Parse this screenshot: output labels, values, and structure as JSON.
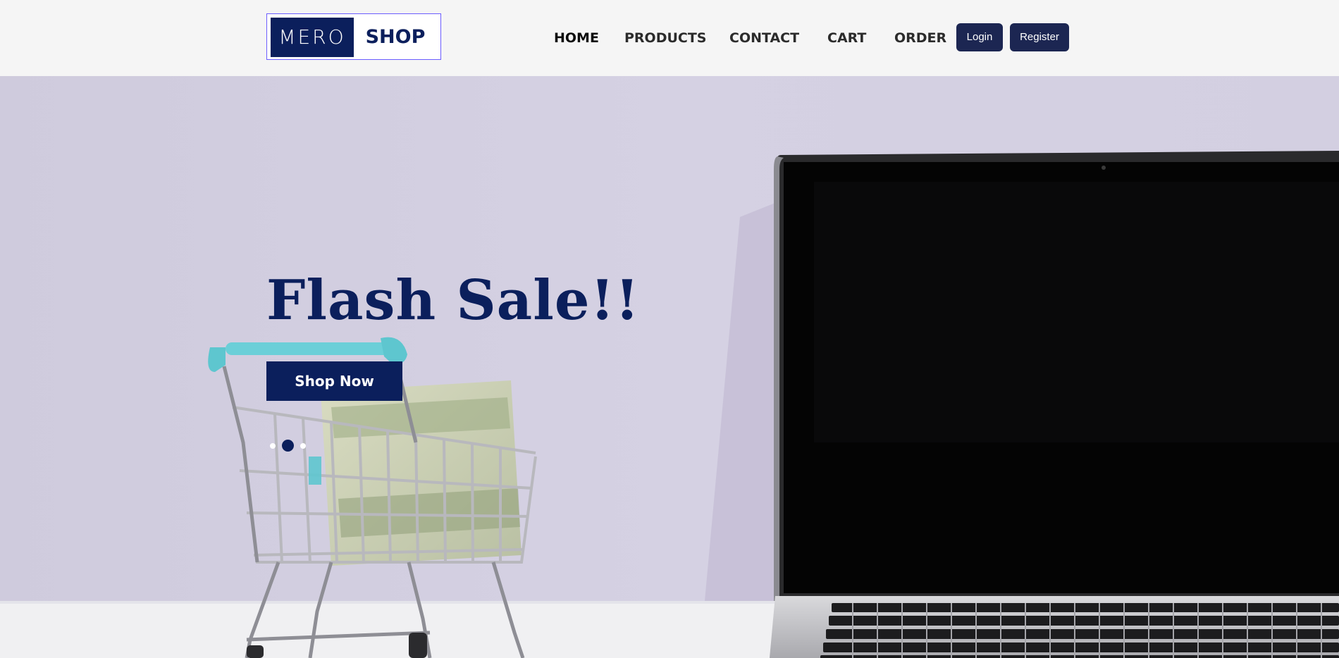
{
  "header": {
    "logo": {
      "left": "MERO",
      "right": "SHOP"
    },
    "nav": [
      {
        "label": "HOME",
        "active": true
      },
      {
        "label": "PRODUCTS",
        "active": false
      },
      {
        "label": "CONTACT",
        "active": false
      },
      {
        "label": "CART",
        "active": false
      },
      {
        "label": "ORDER",
        "active": false
      }
    ],
    "login_label": "Login",
    "register_label": "Register"
  },
  "hero": {
    "title": "Flash Sale!!",
    "button_label": "Shop Now",
    "slides_total": 3,
    "active_slide": 2,
    "image_subject": "shopping cart holding dollar bills beside an open laptop"
  },
  "colors": {
    "brand_navy": "#0b1f5c",
    "button_navy": "#1c2652",
    "logo_border": "#6b5cff",
    "header_bg": "#f5f5f5",
    "hero_bg": "#d2cfe0"
  }
}
